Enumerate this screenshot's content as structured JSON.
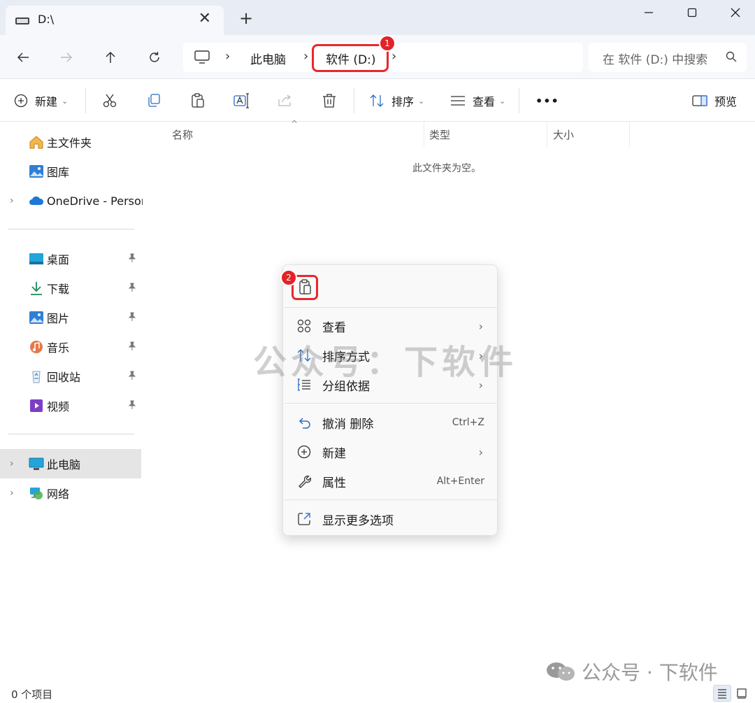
{
  "window": {
    "tab_title": "D:\\",
    "tab_close": "✕",
    "new_tab": "+"
  },
  "navigation": {
    "back": "back",
    "forward": "forward",
    "up": "up",
    "refresh": "refresh"
  },
  "address_bar": {
    "separator": "›",
    "crumbs": [
      "此电脑",
      "软件 (D:)"
    ],
    "badge_1": "1"
  },
  "search": {
    "placeholder": "在 软件 (D:) 中搜索"
  },
  "toolbar": {
    "new_label": "新建",
    "sort_label": "排序",
    "view_label": "查看",
    "more_label": "•••",
    "preview_label": "预览"
  },
  "sidebar": {
    "items": [
      {
        "label": "主文件夹"
      },
      {
        "label": "图库"
      },
      {
        "label": "OneDrive - Person"
      },
      {
        "label": "桌面"
      },
      {
        "label": "下载"
      },
      {
        "label": "图片"
      },
      {
        "label": "音乐"
      },
      {
        "label": "回收站"
      },
      {
        "label": "视频"
      },
      {
        "label": "此电脑"
      },
      {
        "label": "网络"
      }
    ]
  },
  "content": {
    "columns": [
      "名称",
      "类型",
      "大小"
    ],
    "empty_message": "此文件夹为空。"
  },
  "context_menu": {
    "badge_2": "2",
    "items": [
      {
        "label": "查看",
        "shortcut": "",
        "arrow": "›"
      },
      {
        "label": "排序方式",
        "shortcut": "",
        "arrow": "›"
      },
      {
        "label": "分组依据",
        "shortcut": "",
        "arrow": "›"
      },
      {
        "label": "撤消 删除",
        "shortcut": "Ctrl+Z",
        "arrow": ""
      },
      {
        "label": "新建",
        "shortcut": "",
        "arrow": "›"
      },
      {
        "label": "属性",
        "shortcut": "Alt+Enter",
        "arrow": ""
      },
      {
        "label": "显示更多选项",
        "shortcut": "",
        "arrow": ""
      }
    ]
  },
  "watermark": {
    "center": "公众号：下软件",
    "footer": "公众号 · 下软件"
  },
  "status_bar": {
    "item_count": "0 个项目"
  },
  "colors": {
    "accent": "#0067c0",
    "highlight_red": "#e8282d",
    "selected_bg": "#e5e5e5"
  }
}
